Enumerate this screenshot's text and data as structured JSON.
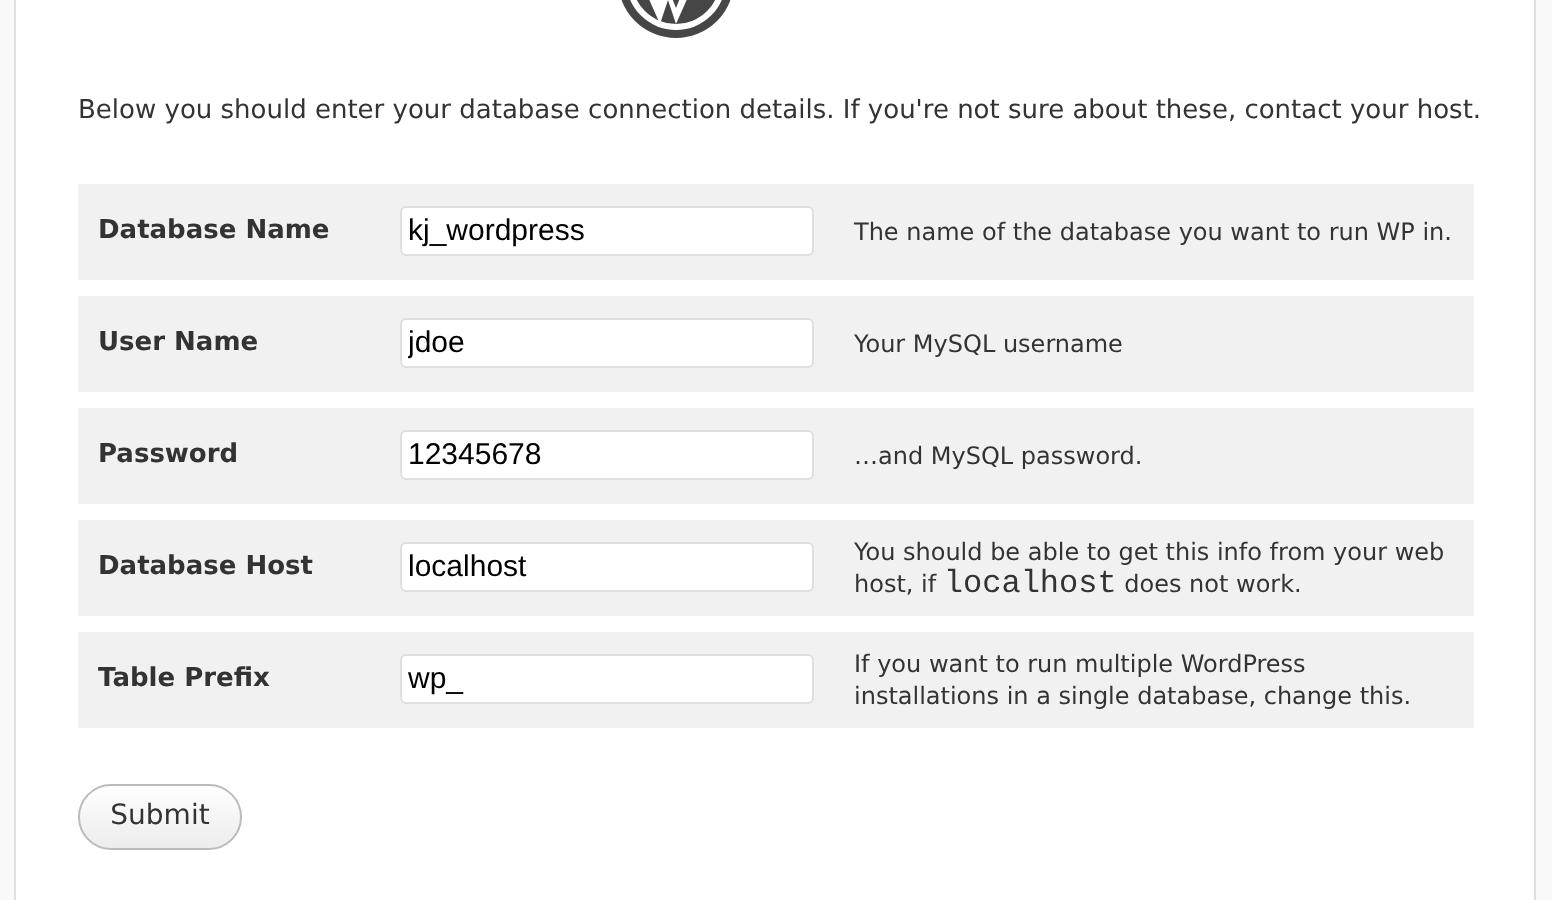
{
  "intro": "Below you should enter your database connection details. If you're not sure about these, contact your host.",
  "fields": [
    {
      "label": "Database Name",
      "value": "kj_wordpress",
      "help": [
        {
          "kind": "text",
          "text": "The name of the database you want to run WP in."
        }
      ]
    },
    {
      "label": "User Name",
      "value": "jdoe",
      "help": [
        {
          "kind": "text",
          "text": "Your MySQL username"
        }
      ]
    },
    {
      "label": "Password",
      "value": "12345678",
      "help": [
        {
          "kind": "text",
          "text": "…and MySQL password."
        }
      ]
    },
    {
      "label": "Database Host",
      "value": "localhost",
      "help": [
        {
          "kind": "text",
          "text": "You should be able to get this info from your web host, if "
        },
        {
          "kind": "code",
          "text": "localhost"
        },
        {
          "kind": "text",
          "text": " does not work."
        }
      ]
    },
    {
      "label": "Table Prefix",
      "value": "wp_",
      "help": [
        {
          "kind": "text",
          "text": "If you want to run multiple WordPress installations in a single database, change this."
        }
      ]
    }
  ],
  "submit": "Submit"
}
